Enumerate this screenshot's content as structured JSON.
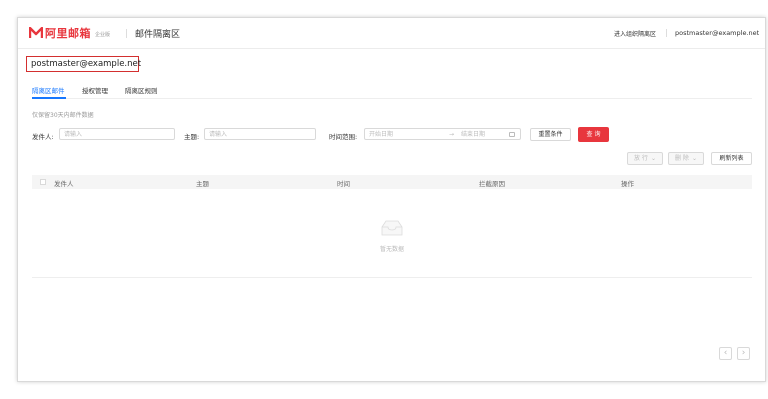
{
  "brand": {
    "logo_text": "阿里邮箱",
    "logo_sub": "企业版",
    "accent": "#e8363d"
  },
  "header": {
    "title": "邮件隔离区",
    "enter_link": "进入组织隔离区",
    "user_email": "postmaster@example.net"
  },
  "account": {
    "email": "postmaster@example.net"
  },
  "tabs": [
    {
      "label": "隔离区邮件",
      "active": true
    },
    {
      "label": "授权管理",
      "active": false
    },
    {
      "label": "隔离区规则",
      "active": false
    }
  ],
  "hint": "仅保留30天内邮件数据",
  "filters": {
    "sender_label": "发件人:",
    "sender_placeholder": "请输入",
    "subject_label": "主题:",
    "subject_placeholder": "请输入",
    "time_label": "时间范围:",
    "start_placeholder": "开始日期",
    "range_arrow": "→",
    "end_placeholder": "结束日期",
    "reset_label": "重置条件",
    "search_label": "查 询"
  },
  "actions": {
    "release_label": "放 行",
    "delete_label": "删 除",
    "refresh_label": "刷新列表"
  },
  "table": {
    "columns": [
      "发件人",
      "主题",
      "时间",
      "拦截原因",
      "操作"
    ],
    "empty_text": "暂无数据"
  },
  "pager": {
    "prev": "‹",
    "next": "›"
  },
  "colors": {
    "primary_blue": "#1677ff",
    "danger_red": "#d32f2f"
  }
}
